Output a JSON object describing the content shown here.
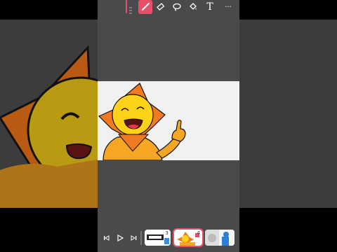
{
  "toolbar": {
    "tools": [
      {
        "name": "handle-icon"
      },
      {
        "name": "brush-icon",
        "active": true
      },
      {
        "name": "eraser-icon"
      },
      {
        "name": "lasso-icon"
      },
      {
        "name": "fill-bucket-icon"
      },
      {
        "name": "text-tool-icon"
      },
      {
        "name": "more-options-icon"
      }
    ],
    "text_tool_label": "T",
    "more_label": "···"
  },
  "playback": {
    "first_frame_label": "|◀",
    "play_label": "▶",
    "last_frame_label": "▶|"
  },
  "frames": [
    {
      "number": "3"
    },
    {
      "number": "4"
    },
    {
      "number": ""
    }
  ],
  "colors": {
    "accent": "#e8506a",
    "canvas": "#f1f1f1",
    "panel": "#4a4a4d",
    "star_orange": "#f07a22",
    "face_yellow": "#ffd21a",
    "body_orange": "#f5a623"
  }
}
